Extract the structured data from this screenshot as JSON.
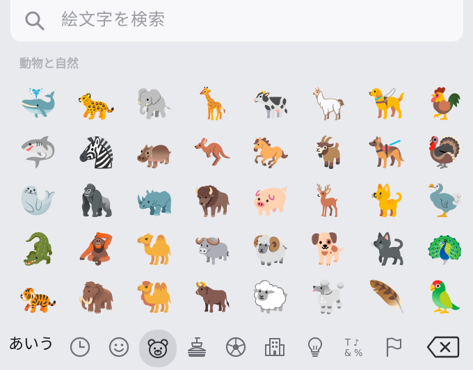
{
  "search": {
    "placeholder": "絵文字を検索"
  },
  "section": {
    "title": "動物と自然"
  },
  "emojis": [
    "🐳",
    "🐆",
    "🐘",
    "🦒",
    "🐄",
    "🦙",
    "🦮",
    "🐓",
    "🦈",
    "🦓",
    "🦛",
    "🦘",
    "🐎",
    "🐐",
    "🐕‍🦺",
    "🦃",
    "🦭",
    "🦍",
    "🦏",
    "🦬",
    "🐖",
    "🦌",
    "🐈",
    "🦤",
    "🐊",
    "🦧",
    "🐪",
    "🐃",
    "🐏",
    "🐕",
    "🐈‍⬛",
    "🦚",
    "🐅",
    "🦣",
    "🐫",
    "🐂",
    "🐑",
    "🐩",
    "🪶",
    "🦜"
  ],
  "toolbar": {
    "kana_label": "あいう",
    "categories": [
      {
        "name": "clock-icon",
        "selected": false
      },
      {
        "name": "smiley-icon",
        "selected": false
      },
      {
        "name": "bear-face-icon",
        "selected": true
      },
      {
        "name": "burger-drink-icon",
        "selected": false
      },
      {
        "name": "soccer-ball-icon",
        "selected": false
      },
      {
        "name": "building-icon",
        "selected": false
      },
      {
        "name": "lightbulb-icon",
        "selected": false
      },
      {
        "name": "symbols-icon",
        "selected": false
      },
      {
        "name": "flag-icon",
        "selected": false
      }
    ],
    "symbols_glyph": "T♪\n&%"
  }
}
